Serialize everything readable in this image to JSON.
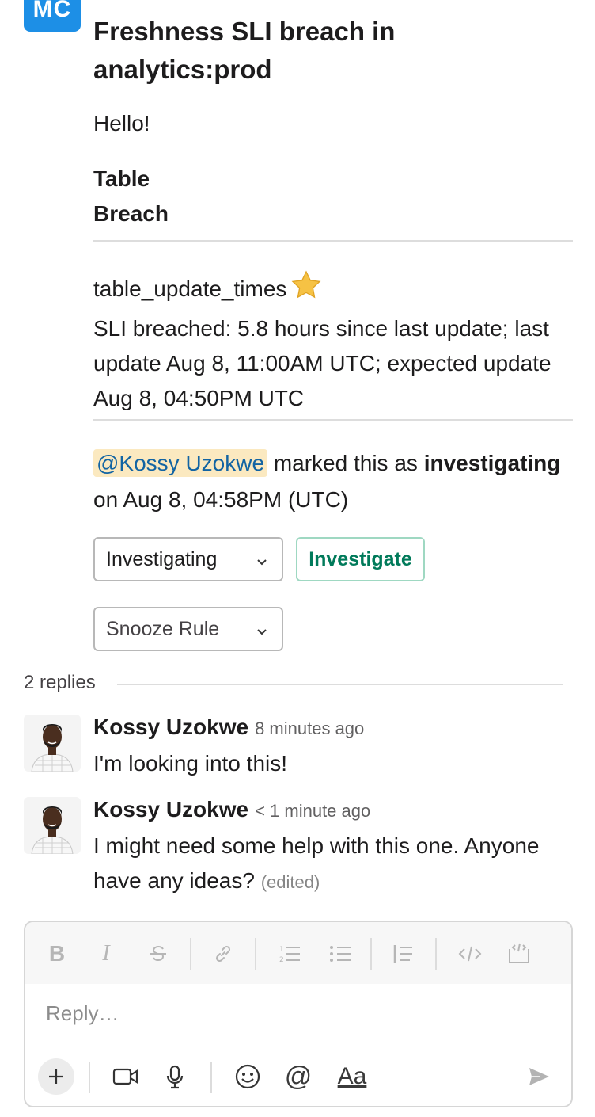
{
  "sender": {
    "avatar_initials": "MC",
    "avatar_color": "#1d8fe6"
  },
  "message": {
    "title": "Freshness SLI breach in analytics:prod",
    "greeting": "Hello!",
    "label_1": "Table",
    "label_2": "Breach",
    "table_name": "table_update_times",
    "table_emoji": "star",
    "details_1": "SLI breached: 5.8 hours since last update; last update Aug 8, 11:00AM UTC; expected update Aug 8, 04:50PM UTC",
    "mention": "@Kossy Uzokwe",
    "marked_text": " marked this as ",
    "status_word": "investigating",
    "marked_on": "on Aug 8, 04:58PM (UTC)"
  },
  "actions": {
    "status_select": "Investigating",
    "investigate_button": "Investigate",
    "snooze_select": "Snooze Rule"
  },
  "thread": {
    "replies_count": "2 replies",
    "replies": [
      {
        "author": "Kossy Uzokwe",
        "time": "8 minutes ago",
        "text": "I'm looking into this!",
        "edited": ""
      },
      {
        "author": "Kossy Uzokwe",
        "time": "< 1 minute ago",
        "text": "I might need some help with this one. Anyone have any ideas?",
        "edited": "(edited)"
      }
    ]
  },
  "composer": {
    "placeholder": "Reply…",
    "toolbar_icons": [
      "bold-icon",
      "italic-icon",
      "strikethrough-icon",
      "link-icon",
      "ordered-list-icon",
      "bulleted-list-icon",
      "blockquote-icon",
      "code-icon",
      "code-block-icon"
    ],
    "bottom_icons": [
      "plus-icon",
      "video-icon",
      "microphone-icon",
      "emoji-icon",
      "mention-icon",
      "formatting-icon",
      "send-icon"
    ],
    "format_label": "Aa"
  },
  "colors": {
    "accent_green": "#007a5a",
    "mention_bg": "#fbe9c0",
    "mention_text": "#1264a3",
    "star": "#f6c244"
  }
}
